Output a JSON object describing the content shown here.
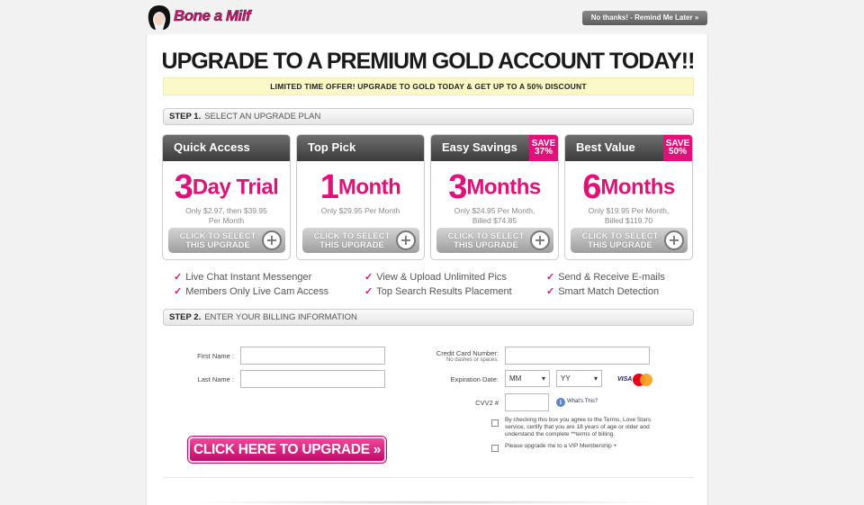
{
  "header": {
    "logo_text": "Bone a Milf",
    "no_thanks": "No thanks! - Remind Me Later »"
  },
  "headline": "UPGRADE TO A PREMIUM GOLD ACCOUNT TODAY!!",
  "offer": "LIMITED TIME OFFER! UPGRADE TO GOLD TODAY & GET UP TO A 50% DISCOUNT",
  "step1": {
    "num": "STEP 1.",
    "text": "SELECT AN UPGRADE PLAN"
  },
  "plans": [
    {
      "name": "Quick Access",
      "save_top": "",
      "save_bottom": "",
      "big_num": "3",
      "big_unit": "Day Trial",
      "desc1": "Only $2.97, then $39.95",
      "desc2": "Per Month",
      "button": "CLICK TO SELECT THIS UPGRADE"
    },
    {
      "name": "Top Pick",
      "save_top": "",
      "save_bottom": "",
      "big_num": "1",
      "big_unit": "Month",
      "desc1": "Only $29.95 Per Month",
      "desc2": "",
      "button": "CLICK TO SELECT THIS UPGRADE"
    },
    {
      "name": "Easy Savings",
      "save_top": "SAVE",
      "save_bottom": "37%",
      "big_num": "3",
      "big_unit": "Months",
      "desc1": "Only $24.95 Per Month,",
      "desc2": "Billed $74.85",
      "button": "CLICK TO SELECT THIS UPGRADE"
    },
    {
      "name": "Best Value",
      "save_top": "SAVE",
      "save_bottom": "50%",
      "big_num": "6",
      "big_unit": "Months",
      "desc1": "Only $19.95 Per Month,",
      "desc2": "Billed $119.70",
      "button": "CLICK TO SELECT THIS UPGRADE"
    }
  ],
  "features": [
    "Live Chat Instant Messenger",
    "View & Upload Unlimited Pics",
    "Send & Receive E-mails",
    "Members Only Live Cam Access",
    "Top Search Results Placement",
    "Smart Match Detection"
  ],
  "check_mark": "✓",
  "step2": {
    "num": "STEP 2.",
    "text": "ENTER YOUR BILLING INFORMATION"
  },
  "billing": {
    "first_name_label": "First Name :",
    "last_name_label": "Last Name :",
    "card_label": "Credit Card Number:",
    "card_hint": "No dashes or spaces.",
    "exp_label": "Expiration Date:",
    "month_value": "MM",
    "year_value": "YY",
    "visa_text": "VISA",
    "cvv_label": "CVV2 #",
    "whats_this": "What's This?",
    "terms_text": "By checking this box you agree to the Terms, Love Stars service, certify that you are 18 years of age or older and understand the complete **terms of billing.",
    "vip_text": "Please upgrade me to a VIP Membership +"
  },
  "cta": "CLICK HERE TO UPGRADE »",
  "colors": {
    "brand": "#e0127a",
    "offer_bg": "#fbf9c8"
  }
}
